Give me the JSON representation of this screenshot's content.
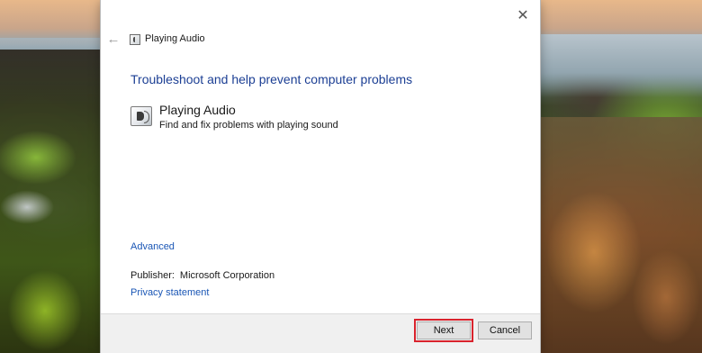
{
  "window": {
    "close_glyph": "✕",
    "back_glyph": "←",
    "nav_title": "Playing Audio"
  },
  "main": {
    "heading": "Troubleshoot and help prevent computer problems",
    "item": {
      "icon": "speaker-icon",
      "title": "Playing Audio",
      "description": "Find and fix problems with playing sound"
    },
    "advanced_link": "Advanced",
    "publisher_label": "Publisher:",
    "publisher_value": "Microsoft Corporation",
    "privacy_link": "Privacy statement"
  },
  "footer": {
    "next_label": "Next",
    "cancel_label": "Cancel",
    "highlight_color": "#d9232d"
  },
  "colors": {
    "heading": "#1c3f94",
    "link": "#1a56b5"
  }
}
